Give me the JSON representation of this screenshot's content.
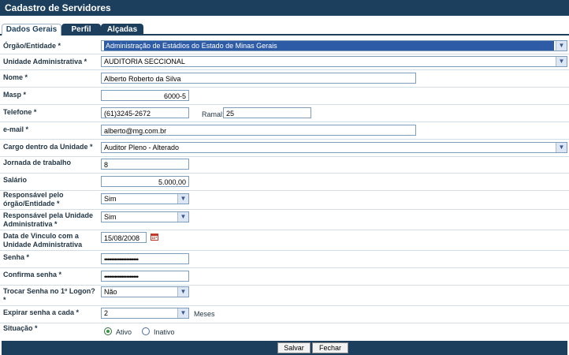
{
  "window": {
    "title": "Cadastro de Servidores"
  },
  "tabs": [
    {
      "label": "Dados Gerais"
    },
    {
      "label": "Perfil"
    },
    {
      "label": "Alçadas"
    }
  ],
  "form": {
    "orgao": {
      "label": "Órgão/Entidade *",
      "value": "Administração de Estádios do Estado de Minas Gerais"
    },
    "unidade": {
      "label": "Unidade Administrativa *",
      "value": "AUDITORIA SECCIONAL"
    },
    "nome": {
      "label": "Nome *",
      "value": "Alberto Roberto da Silva"
    },
    "masp": {
      "label": "Masp *",
      "value": "6000-5"
    },
    "telefone": {
      "label": "Telefone *",
      "value": "(61)3245-2672",
      "ramal_label": "Ramal:",
      "ramal_value": "25"
    },
    "email": {
      "label": "e-mail *",
      "value": "alberto@mg.com.br"
    },
    "cargo": {
      "label": "Cargo dentro da Unidade *",
      "value": "Auditor Pleno - Alterado"
    },
    "jornada": {
      "label": "Jornada de trabalho",
      "value": "8"
    },
    "salario": {
      "label": "Salário",
      "value": "5.000,00"
    },
    "resp_orgao": {
      "label_1": "Responsável pelo",
      "label_2": "órgão/Entidade *",
      "value": "Sim"
    },
    "resp_unidade": {
      "label_1": "Responsável pela Unidade",
      "label_2": "Administrativa *",
      "value": "Sim"
    },
    "data_vinculo": {
      "label_1": "Data de Vinculo com a",
      "label_2": "Unidade Administrativa",
      "value": "15/08/2008"
    },
    "senha": {
      "label": "Senha *",
      "value": "••••••••••••••••••••"
    },
    "confirma": {
      "label": "Confirma senha *",
      "value": "••••••••••••••••••••"
    },
    "trocar": {
      "label_1": "Trocar Senha no 1º Logon?",
      "label_2": "*",
      "value": "Não"
    },
    "expirar": {
      "label": "Expirar senha a cada *",
      "value": "2",
      "unit": "Meses"
    },
    "situacao": {
      "label": "Situação *",
      "opt_ativo": "Ativo",
      "opt_inativo": "Inativo",
      "selected": "Ativo"
    }
  },
  "buttons": {
    "salvar": "Salvar",
    "fechar": "Fechar"
  },
  "colors": {
    "header": "#1c3f5e",
    "selection": "#2d5ba6"
  }
}
